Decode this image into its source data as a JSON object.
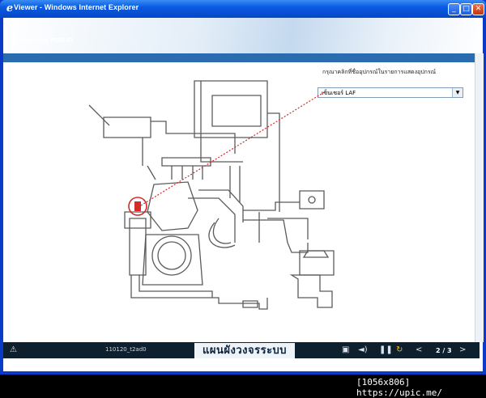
{
  "window": {
    "title": "Viewer - Windows Internet Explorer",
    "btn_minimize": "_",
    "btn_maximize": "□",
    "btn_close": "✕"
  },
  "nav": {
    "section_label": "คำอธิบายระบบ PGM-FI"
  },
  "panel": {
    "instruction": "กรุณาคลิกที่ชื่ออุปกรณ์ในรายการแสดงอุปกรณ์",
    "dropdown_value": "เซ็นเซอร์ LAF"
  },
  "player": {
    "slide_id": "110120_t2ad0",
    "caption": "แผนผังวงจรระบบ",
    "page_counter": "2 / 3"
  },
  "footer": {
    "text": "[1056x806] https://upic.me/"
  },
  "colors": {
    "highlight": "#d42a2a",
    "line": "#5a5a5a",
    "player_bg": "#0e1f2e"
  },
  "icons": [
    "ie-icon",
    "warning-icon",
    "book-icon",
    "speaker-icon",
    "pause-icon",
    "replay-icon",
    "prev-icon",
    "next-icon"
  ]
}
